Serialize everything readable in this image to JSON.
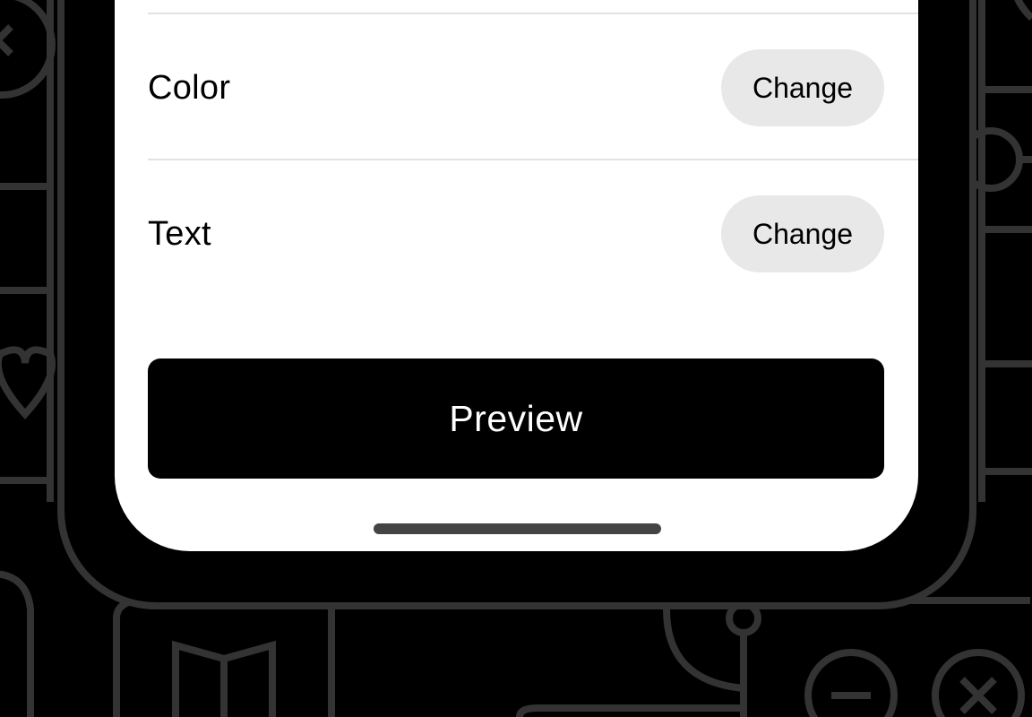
{
  "settings": {
    "rows": [
      {
        "label": "Color",
        "action_label": "Change"
      },
      {
        "label": "Text",
        "action_label": "Change"
      }
    ]
  },
  "actions": {
    "preview_label": "Preview"
  },
  "icons": {
    "background": [
      "close-icon",
      "heart-icon",
      "book-icon",
      "minus-icon",
      "close-icon"
    ]
  },
  "colors": {
    "background": "#000000",
    "screen": "#ffffff",
    "primary_button": "#000000",
    "secondary_button": "#e8e8e8",
    "divider": "#e2e2e2",
    "line_art": "#333333"
  }
}
